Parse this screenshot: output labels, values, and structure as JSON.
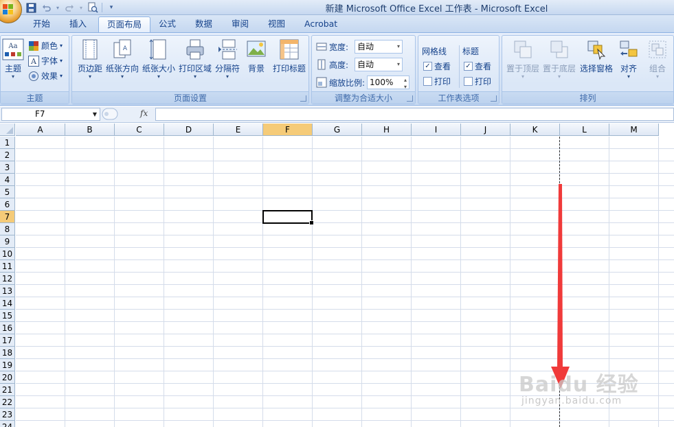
{
  "window": {
    "title": "新建 Microsoft Office Excel 工作表 - Microsoft Excel"
  },
  "quick_access": [
    {
      "name": "save-icon"
    },
    {
      "name": "undo-icon"
    },
    {
      "name": "redo-icon"
    },
    {
      "name": "print-preview-icon"
    },
    {
      "name": "customize-qat-icon"
    }
  ],
  "tabs": [
    {
      "label": "开始",
      "active": false
    },
    {
      "label": "插入",
      "active": false
    },
    {
      "label": "页面布局",
      "active": true
    },
    {
      "label": "公式",
      "active": false
    },
    {
      "label": "数据",
      "active": false
    },
    {
      "label": "审阅",
      "active": false
    },
    {
      "label": "视图",
      "active": false
    },
    {
      "label": "Acrobat",
      "active": false
    }
  ],
  "ribbon": {
    "themes": {
      "label": "主题",
      "theme_button": "主题",
      "colors": "颜色",
      "fonts": "字体",
      "effects": "效果"
    },
    "page_setup": {
      "label": "页面设置",
      "buttons": [
        "页边距",
        "纸张方向",
        "纸张大小",
        "打印区域",
        "分隔符",
        "背景",
        "打印标题"
      ]
    },
    "scale_to_fit": {
      "label": "调整为合适大小",
      "width_label": "宽度:",
      "width_value": "自动",
      "height_label": "高度:",
      "height_value": "自动",
      "scale_label": "缩放比例:",
      "scale_value": "100%"
    },
    "sheet_options": {
      "label": "工作表选项",
      "gridlines_title": "网格线",
      "headings_title": "标题",
      "view": "查看",
      "print": "打印",
      "gridlines_view_checked": true,
      "gridlines_print_checked": false,
      "headings_view_checked": true,
      "headings_print_checked": false
    },
    "arrange": {
      "label": "排列",
      "buttons": [
        "置于顶层",
        "置于底层",
        "选择窗格",
        "对齐",
        "组合"
      ]
    }
  },
  "formula_bar": {
    "name_box": "F7",
    "fx": "fx",
    "value": ""
  },
  "sheet": {
    "columns": [
      "A",
      "B",
      "C",
      "D",
      "E",
      "F",
      "G",
      "H",
      "I",
      "J",
      "K",
      "L",
      "M"
    ],
    "rows": [
      "1",
      "2",
      "3",
      "4",
      "5",
      "6",
      "7",
      "8",
      "9",
      "10",
      "11",
      "12",
      "13",
      "14",
      "15",
      "16",
      "17",
      "18",
      "19",
      "20",
      "21",
      "22",
      "23",
      "24"
    ],
    "active_column": "F",
    "active_row": "7"
  },
  "colors": {
    "annotation_arrow": "#f03a3a",
    "selected_header": "#f5cb78",
    "gridline": "#d4dcea"
  },
  "watermark": {
    "main": "Baidu 经验",
    "sub": "jingyan.baidu.com"
  }
}
